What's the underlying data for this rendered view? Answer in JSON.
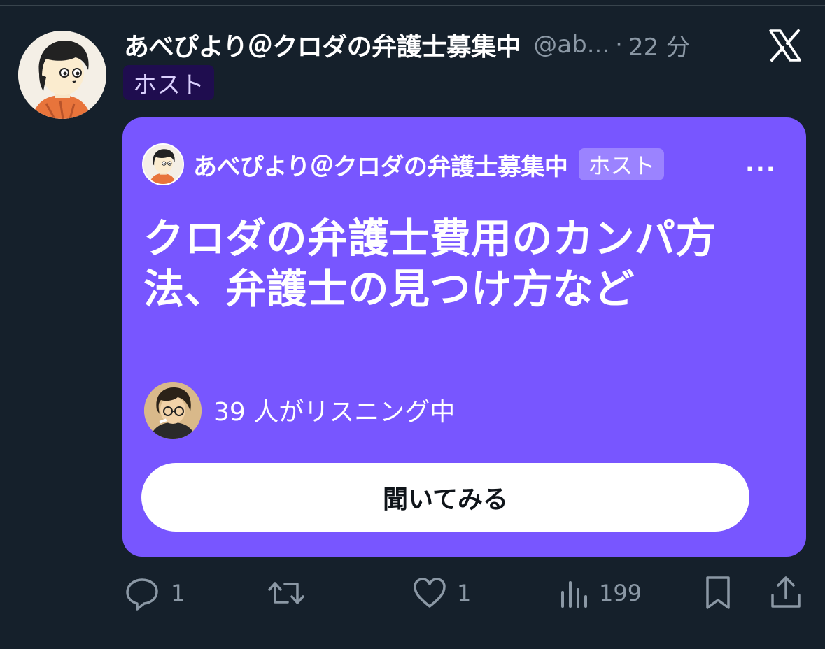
{
  "tweet": {
    "display_name": "あべぴより＠クロダの弁護士募集中",
    "handle": "@ab...",
    "separator": "·",
    "time": "22 分",
    "host_badge": "ホスト"
  },
  "space_card": {
    "host_name": "あべぴより＠クロダの弁護士募集中",
    "host_badge": "ホスト",
    "more": "...",
    "title": "クロダの弁護士費用のカンパ方法、弁護士の見つけ方など",
    "listener_count": "39 人がリスニング中",
    "listen_button": "聞いてみる",
    "background_color": "#7856ff"
  },
  "actions": {
    "reply_count": "1",
    "like_count": "1",
    "views_count": "199"
  },
  "icons": {
    "x_logo": "x-logo-icon",
    "reply": "reply-icon",
    "retweet": "retweet-icon",
    "like": "heart-icon",
    "views": "views-icon",
    "bookmark": "bookmark-icon",
    "share": "share-icon"
  }
}
